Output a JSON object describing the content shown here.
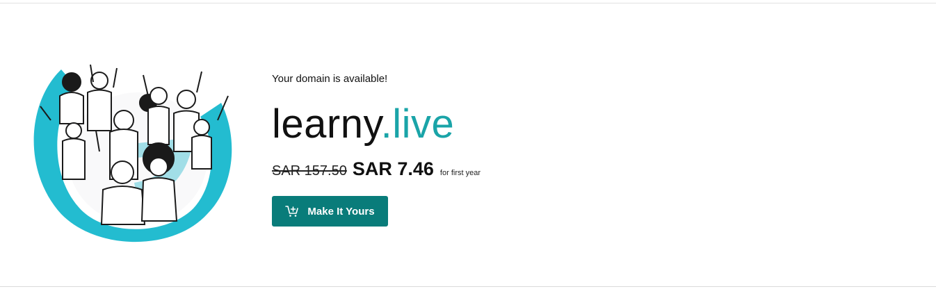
{
  "result": {
    "availability_text": "Your domain is available!",
    "domain": {
      "sld": "learny",
      "tld": ".live"
    },
    "price": {
      "original": "SAR 157.50",
      "current": "SAR 7.46",
      "note": "for first year"
    },
    "cta": {
      "label": "Make It Yours",
      "icon": "add-to-cart-icon"
    },
    "colors": {
      "accent_tld": "#1aa4a8",
      "button_bg": "#097c7a",
      "illustration_ring": "#23bcd0"
    },
    "illustration": "people-crowd-cheering-illustration"
  }
}
